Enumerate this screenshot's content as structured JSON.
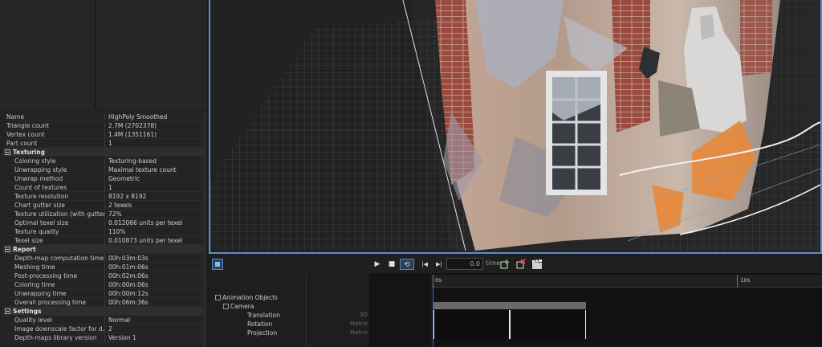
{
  "properties": [
    {
      "kind": "row",
      "key": "Name",
      "value": "HighPoly Smoothed"
    },
    {
      "kind": "row",
      "key": "Triangle count",
      "value": "2.7M (2702378)"
    },
    {
      "kind": "row",
      "key": "Vertex count",
      "value": "1.4M (1351161)"
    },
    {
      "kind": "row",
      "key": "Part count",
      "value": "1"
    },
    {
      "kind": "section",
      "key": "Texturing"
    },
    {
      "kind": "sub",
      "key": "Coloring style",
      "value": "Texturing-based"
    },
    {
      "kind": "sub",
      "key": "Unwrapping style",
      "value": "Maximal texture count"
    },
    {
      "kind": "sub",
      "key": "Unwrap method",
      "value": "Geometric"
    },
    {
      "kind": "sub",
      "key": "Count of textures",
      "value": "1"
    },
    {
      "kind": "sub",
      "key": "Texture resolution",
      "value": "8192 x 8192"
    },
    {
      "kind": "sub",
      "key": "Chart gutter size",
      "value": "2 texels"
    },
    {
      "kind": "sub",
      "key": "Texture utilization (with gutter)",
      "value": "72%"
    },
    {
      "kind": "sub",
      "key": "Optimal texel size",
      "value": "0.012066 units per texel"
    },
    {
      "kind": "sub",
      "key": "Texture quality",
      "value": "110%"
    },
    {
      "kind": "sub",
      "key": "Texel size",
      "value": "0.010873 units per texel"
    },
    {
      "kind": "section",
      "key": "Report"
    },
    {
      "kind": "sub",
      "key": "Depth-map computation time",
      "value": "00h:03m:03s"
    },
    {
      "kind": "sub",
      "key": "Meshing time",
      "value": "00h:01m:06s"
    },
    {
      "kind": "sub",
      "key": "Post-processing time",
      "value": "00h:02m:06s"
    },
    {
      "kind": "sub",
      "key": "Coloring time",
      "value": "00h:00m:06s"
    },
    {
      "kind": "sub",
      "key": "Unwrapping time",
      "value": "00h:00m:12s"
    },
    {
      "kind": "sub",
      "key": "Overall processing time",
      "value": "00h:06m:36s"
    },
    {
      "kind": "section",
      "key": "Settings"
    },
    {
      "kind": "sub",
      "key": "Quality level",
      "value": "Normal"
    },
    {
      "kind": "sub",
      "key": "Image downscale factor for d...",
      "value": "2"
    },
    {
      "kind": "sub",
      "key": "Depth-maps library version",
      "value": "Version 1"
    }
  ],
  "toolbar": {
    "play": "▶",
    "stop": "■",
    "loop": "⟲",
    "prev": "|◀",
    "next": "▶|",
    "time_value": "0.0",
    "time_label": "time"
  },
  "animation": {
    "root": "Animation Objects",
    "camera": "Camera",
    "channels": [
      "Translation",
      "Rotation",
      "Projection"
    ],
    "channel_types": [
      "3D",
      "Matrix",
      "Matrix"
    ],
    "ruler_start": "0s",
    "ruler_mark": "10s"
  },
  "colors": {
    "accent": "#5a8fd0",
    "selection_orange": "#e8883a"
  }
}
